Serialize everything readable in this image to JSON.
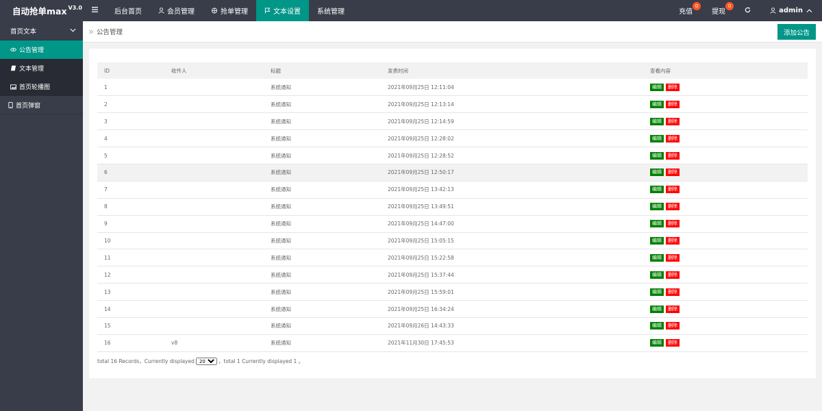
{
  "brand": {
    "name": "自动抢单max",
    "version": "V3.0"
  },
  "nav": {
    "items": [
      {
        "label": "后台首页"
      },
      {
        "label": "会员管理"
      },
      {
        "label": "抢单管理"
      },
      {
        "label": "文本设置"
      },
      {
        "label": "系统管理"
      }
    ],
    "right": {
      "recharge": {
        "label": "充值",
        "count": "0"
      },
      "withdraw": {
        "label": "提现",
        "count": "0"
      },
      "user": "admin"
    }
  },
  "sidebar": {
    "group": "首页文本",
    "items": [
      {
        "label": "公告管理"
      },
      {
        "label": "文本管理"
      },
      {
        "label": "首页轮播图"
      }
    ],
    "extra": "首页弹窗"
  },
  "breadcrumb": "公告管理",
  "add_button": "添加公告",
  "table": {
    "headers": [
      "ID",
      "收件人",
      "标题",
      "发表时间",
      "查看内容"
    ],
    "edit_label": "编辑",
    "delete_label": "删除",
    "rows": [
      {
        "id": "1",
        "recipient": "",
        "title": "系统通知",
        "time": "2021年09月25日 12:11:04"
      },
      {
        "id": "2",
        "recipient": "",
        "title": "系统通知",
        "time": "2021年09月25日 12:13:14"
      },
      {
        "id": "3",
        "recipient": "",
        "title": "系统通知",
        "time": "2021年09月25日 12:14:59"
      },
      {
        "id": "4",
        "recipient": "",
        "title": "系统通知",
        "time": "2021年09月25日 12:28:02"
      },
      {
        "id": "5",
        "recipient": "",
        "title": "系统通知",
        "time": "2021年09月25日 12:28:52"
      },
      {
        "id": "6",
        "recipient": "",
        "title": "系统通知",
        "time": "2021年09月25日 12:50:17"
      },
      {
        "id": "7",
        "recipient": "",
        "title": "系统通知",
        "time": "2021年09月25日 13:42:13"
      },
      {
        "id": "8",
        "recipient": "",
        "title": "系统通知",
        "time": "2021年09月25日 13:49:51"
      },
      {
        "id": "9",
        "recipient": "",
        "title": "系统通知",
        "time": "2021年09月25日 14:47:00"
      },
      {
        "id": "10",
        "recipient": "",
        "title": "系统通知",
        "time": "2021年09月25日 15:05:15"
      },
      {
        "id": "11",
        "recipient": "",
        "title": "系统通知",
        "time": "2021年09月25日 15:22:58"
      },
      {
        "id": "12",
        "recipient": "",
        "title": "系统通知",
        "time": "2021年09月25日 15:37:44"
      },
      {
        "id": "13",
        "recipient": "",
        "title": "系统通知",
        "time": "2021年09月25日 15:59:01"
      },
      {
        "id": "14",
        "recipient": "",
        "title": "系统通知",
        "time": "2021年09月25日 16:34:24"
      },
      {
        "id": "15",
        "recipient": "",
        "title": "系统通知",
        "time": "2021年09月26日 14:43:33"
      },
      {
        "id": "16",
        "recipient": "v8",
        "title": "系统通知",
        "time": "2021年11月30日 17:45:53"
      }
    ]
  },
  "pager": {
    "before": "total 16 Records，Currently displayed",
    "page_size": "20",
    "after": "，total 1 Currently displayed 1 。"
  }
}
